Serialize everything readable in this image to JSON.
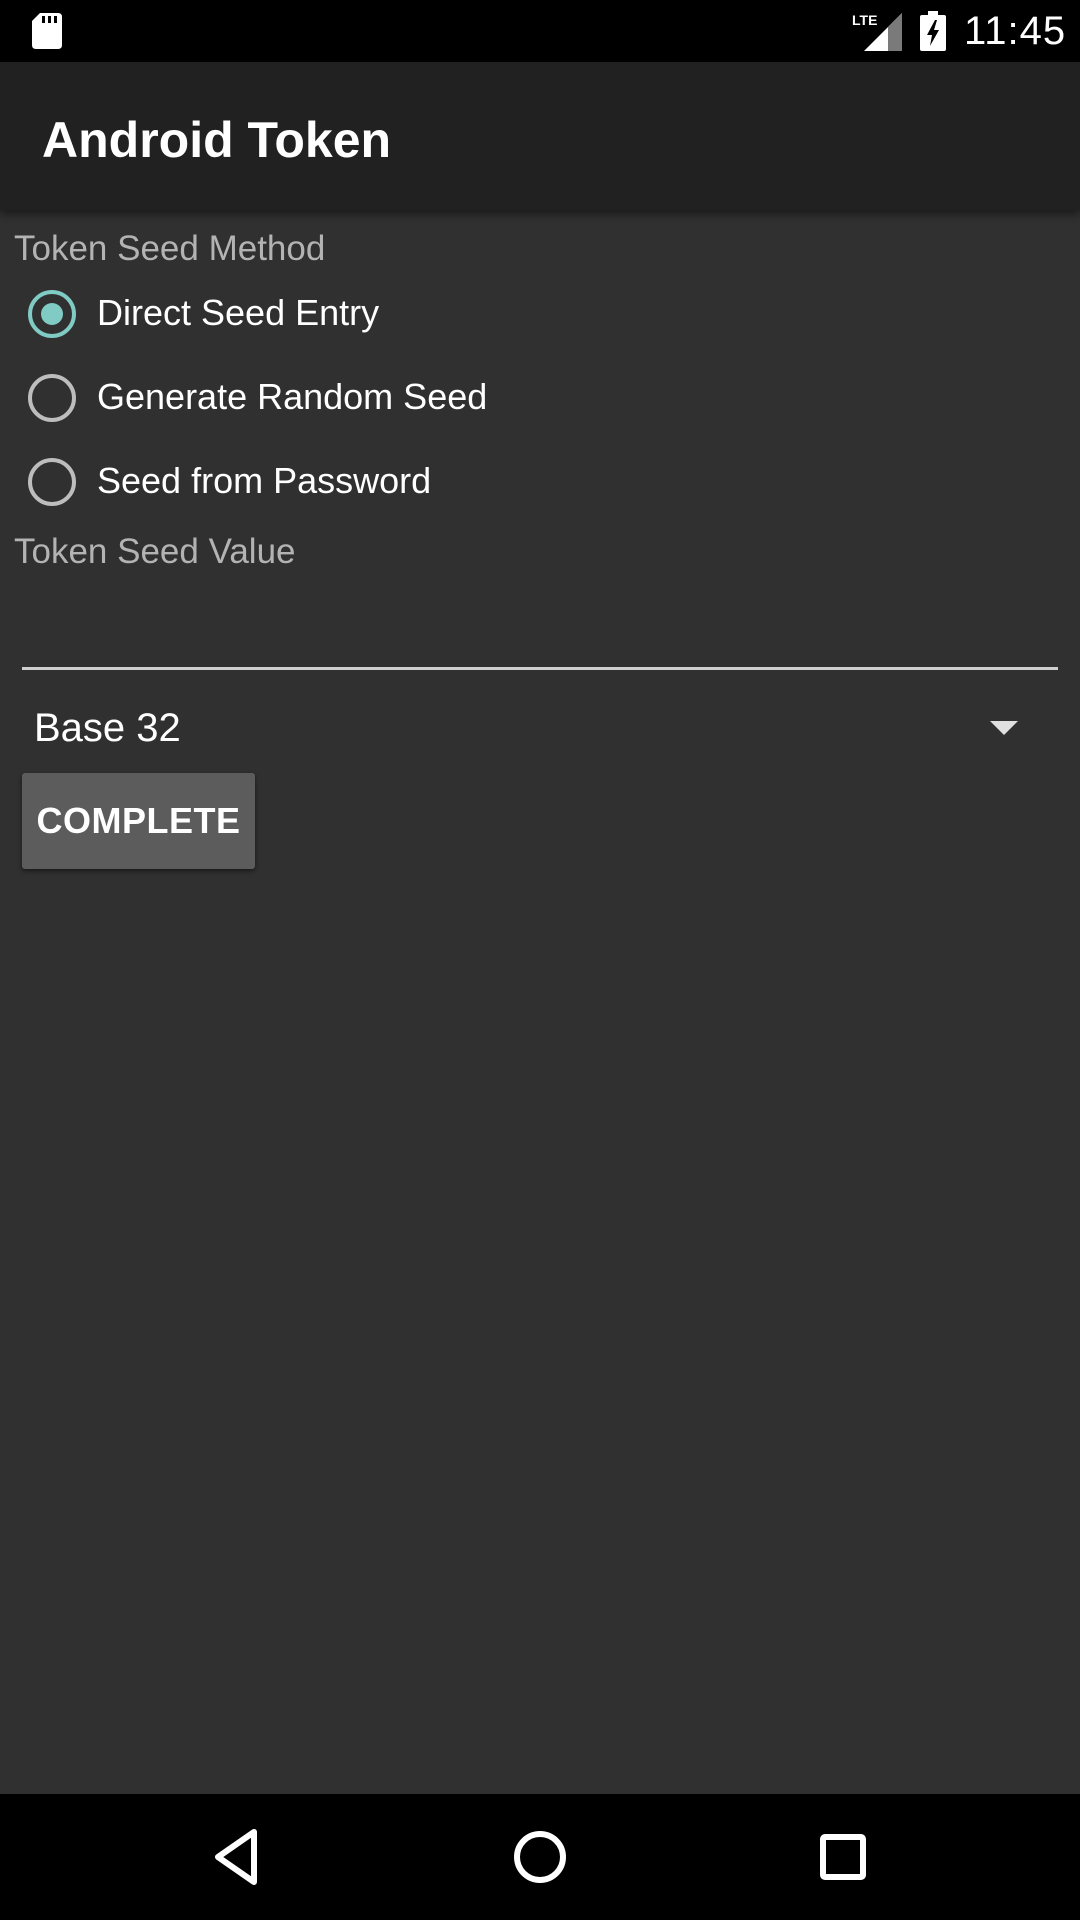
{
  "status_bar": {
    "time": "11:45",
    "icons": [
      "sd-card-icon",
      "lte-signal-icon",
      "battery-charging-icon"
    ],
    "lte_label": "LTE"
  },
  "app_bar": {
    "title": "Android Token"
  },
  "seed_method": {
    "label": "Token Seed Method",
    "options": [
      {
        "label": "Direct Seed Entry",
        "checked": true
      },
      {
        "label": "Generate Random Seed",
        "checked": false
      },
      {
        "label": "Seed from Password",
        "checked": false
      }
    ]
  },
  "seed_value": {
    "label": "Token Seed Value",
    "value": "",
    "placeholder": ""
  },
  "encoding": {
    "selected": "Base 32"
  },
  "actions": {
    "complete_label": "COMPLETE"
  },
  "nav_bar": {
    "icons": [
      "back-icon",
      "home-icon",
      "recents-icon"
    ]
  },
  "colors": {
    "background": "#303030",
    "app_bar": "#212121",
    "accent": "#80cbc4",
    "button": "#5c5c5c"
  }
}
